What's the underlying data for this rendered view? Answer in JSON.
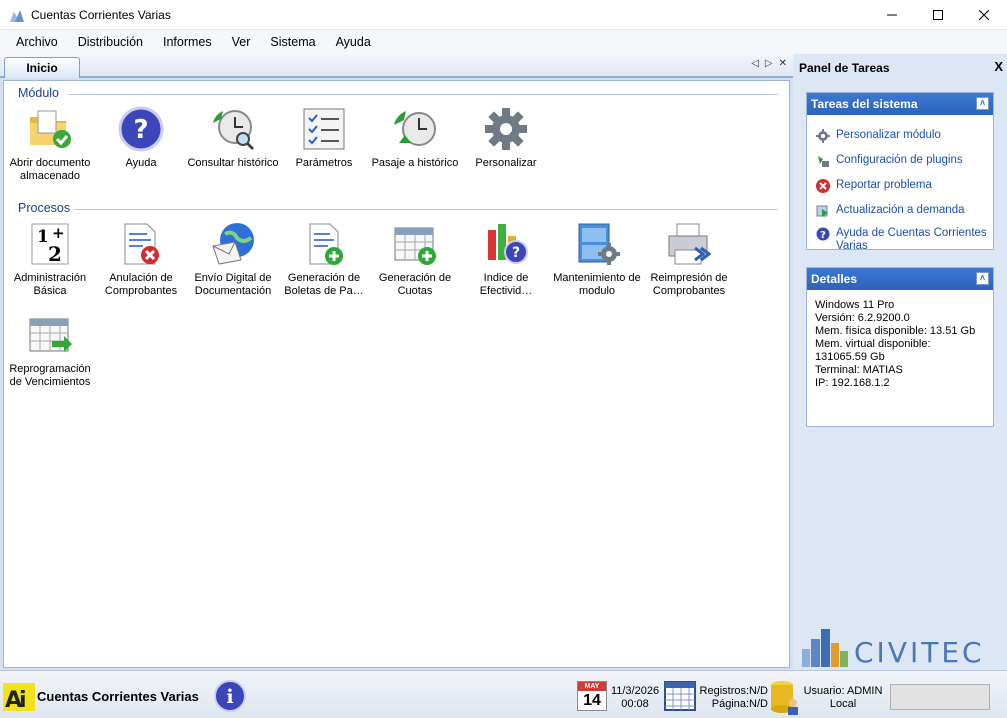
{
  "window": {
    "title": "Cuentas Corrientes Varias"
  },
  "menu": [
    "Archivo",
    "Distribución",
    "Informes",
    "Ver",
    "Sistema",
    "Ayuda"
  ],
  "tab": {
    "label": "Inicio"
  },
  "sections": {
    "modulo": {
      "label": "Módulo",
      "items": [
        {
          "label": "Abrir documento almacenado",
          "icon": "folder-check-icon"
        },
        {
          "label": "Ayuda",
          "icon": "help-icon"
        },
        {
          "label": "Consultar histórico",
          "icon": "history-search-icon"
        },
        {
          "label": "Parámetros",
          "icon": "checklist-icon"
        },
        {
          "label": "Pasaje a histórico",
          "icon": "clock-arrow-icon"
        },
        {
          "label": "Personalizar",
          "icon": "gear-icon"
        }
      ]
    },
    "procesos": {
      "label": "Procesos",
      "items": [
        {
          "label": "Administración Básica",
          "icon": "numbers-icon"
        },
        {
          "label": "Anulación de Comprobantes",
          "icon": "document-cancel-icon"
        },
        {
          "label": "Envío Digital de Documentación",
          "icon": "globe-mail-icon"
        },
        {
          "label": "Generación de Boletas de Pa…",
          "icon": "document-add-icon"
        },
        {
          "label": "Generación de Cuotas",
          "icon": "calendar-add-icon"
        },
        {
          "label": "Indice de Efectivid…",
          "icon": "chart-help-icon"
        },
        {
          "label": "Mantenimiento de modulo",
          "icon": "cabinet-gear-icon"
        },
        {
          "label": "Reimpresión de Comprobantes",
          "icon": "printer-icon"
        },
        {
          "label": "Reprogramación de Vencimientos",
          "icon": "calendar-arrow-icon"
        }
      ]
    }
  },
  "taskpane": {
    "title": "Panel de Tareas",
    "close": "X",
    "system": {
      "title": "Tareas del sistema",
      "items": [
        "Personalizar módulo",
        "Configuración de plugins",
        "Reportar problema",
        "Actualización a demanda",
        "Ayuda de Cuentas Corrientes Varias"
      ]
    },
    "details": {
      "title": "Detalles",
      "lines": [
        "Windows 11 Pro",
        "Versión: 6.2.9200.0",
        "Mem. física disponible: 13.51 Gb",
        "Mem. virtual disponible:",
        "131065.59 Gb",
        "Terminal: MATIAS",
        "IP: 192.168.1.2"
      ]
    },
    "logo": "CIVITEC"
  },
  "status": {
    "app_name": "Cuentas Corrientes Varias",
    "calendar_month": "MAY",
    "calendar_day": "14",
    "date": "11/3/2026",
    "time": "00:08",
    "registros": "Registros:N/D",
    "pagina": "Página:N/D",
    "usuario": "Usuario: ADMIN",
    "local": "Local"
  }
}
